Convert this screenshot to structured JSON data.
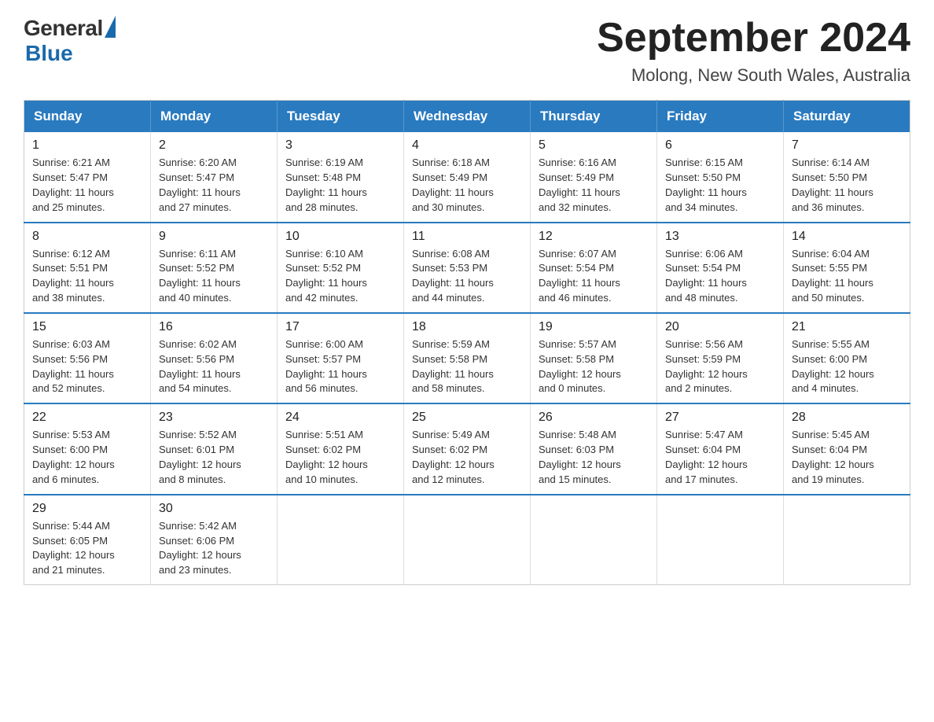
{
  "logo": {
    "general_text": "General",
    "blue_text": "Blue"
  },
  "header": {
    "title": "September 2024",
    "subtitle": "Molong, New South Wales, Australia"
  },
  "weekdays": [
    "Sunday",
    "Monday",
    "Tuesday",
    "Wednesday",
    "Thursday",
    "Friday",
    "Saturday"
  ],
  "weeks": [
    [
      {
        "day": "1",
        "sunrise": "6:21 AM",
        "sunset": "5:47 PM",
        "daylight": "11 hours and 25 minutes."
      },
      {
        "day": "2",
        "sunrise": "6:20 AM",
        "sunset": "5:47 PM",
        "daylight": "11 hours and 27 minutes."
      },
      {
        "day": "3",
        "sunrise": "6:19 AM",
        "sunset": "5:48 PM",
        "daylight": "11 hours and 28 minutes."
      },
      {
        "day": "4",
        "sunrise": "6:18 AM",
        "sunset": "5:49 PM",
        "daylight": "11 hours and 30 minutes."
      },
      {
        "day": "5",
        "sunrise": "6:16 AM",
        "sunset": "5:49 PM",
        "daylight": "11 hours and 32 minutes."
      },
      {
        "day": "6",
        "sunrise": "6:15 AM",
        "sunset": "5:50 PM",
        "daylight": "11 hours and 34 minutes."
      },
      {
        "day": "7",
        "sunrise": "6:14 AM",
        "sunset": "5:50 PM",
        "daylight": "11 hours and 36 minutes."
      }
    ],
    [
      {
        "day": "8",
        "sunrise": "6:12 AM",
        "sunset": "5:51 PM",
        "daylight": "11 hours and 38 minutes."
      },
      {
        "day": "9",
        "sunrise": "6:11 AM",
        "sunset": "5:52 PM",
        "daylight": "11 hours and 40 minutes."
      },
      {
        "day": "10",
        "sunrise": "6:10 AM",
        "sunset": "5:52 PM",
        "daylight": "11 hours and 42 minutes."
      },
      {
        "day": "11",
        "sunrise": "6:08 AM",
        "sunset": "5:53 PM",
        "daylight": "11 hours and 44 minutes."
      },
      {
        "day": "12",
        "sunrise": "6:07 AM",
        "sunset": "5:54 PM",
        "daylight": "11 hours and 46 minutes."
      },
      {
        "day": "13",
        "sunrise": "6:06 AM",
        "sunset": "5:54 PM",
        "daylight": "11 hours and 48 minutes."
      },
      {
        "day": "14",
        "sunrise": "6:04 AM",
        "sunset": "5:55 PM",
        "daylight": "11 hours and 50 minutes."
      }
    ],
    [
      {
        "day": "15",
        "sunrise": "6:03 AM",
        "sunset": "5:56 PM",
        "daylight": "11 hours and 52 minutes."
      },
      {
        "day": "16",
        "sunrise": "6:02 AM",
        "sunset": "5:56 PM",
        "daylight": "11 hours and 54 minutes."
      },
      {
        "day": "17",
        "sunrise": "6:00 AM",
        "sunset": "5:57 PM",
        "daylight": "11 hours and 56 minutes."
      },
      {
        "day": "18",
        "sunrise": "5:59 AM",
        "sunset": "5:58 PM",
        "daylight": "11 hours and 58 minutes."
      },
      {
        "day": "19",
        "sunrise": "5:57 AM",
        "sunset": "5:58 PM",
        "daylight": "12 hours and 0 minutes."
      },
      {
        "day": "20",
        "sunrise": "5:56 AM",
        "sunset": "5:59 PM",
        "daylight": "12 hours and 2 minutes."
      },
      {
        "day": "21",
        "sunrise": "5:55 AM",
        "sunset": "6:00 PM",
        "daylight": "12 hours and 4 minutes."
      }
    ],
    [
      {
        "day": "22",
        "sunrise": "5:53 AM",
        "sunset": "6:00 PM",
        "daylight": "12 hours and 6 minutes."
      },
      {
        "day": "23",
        "sunrise": "5:52 AM",
        "sunset": "6:01 PM",
        "daylight": "12 hours and 8 minutes."
      },
      {
        "day": "24",
        "sunrise": "5:51 AM",
        "sunset": "6:02 PM",
        "daylight": "12 hours and 10 minutes."
      },
      {
        "day": "25",
        "sunrise": "5:49 AM",
        "sunset": "6:02 PM",
        "daylight": "12 hours and 12 minutes."
      },
      {
        "day": "26",
        "sunrise": "5:48 AM",
        "sunset": "6:03 PM",
        "daylight": "12 hours and 15 minutes."
      },
      {
        "day": "27",
        "sunrise": "5:47 AM",
        "sunset": "6:04 PM",
        "daylight": "12 hours and 17 minutes."
      },
      {
        "day": "28",
        "sunrise": "5:45 AM",
        "sunset": "6:04 PM",
        "daylight": "12 hours and 19 minutes."
      }
    ],
    [
      {
        "day": "29",
        "sunrise": "5:44 AM",
        "sunset": "6:05 PM",
        "daylight": "12 hours and 21 minutes."
      },
      {
        "day": "30",
        "sunrise": "5:42 AM",
        "sunset": "6:06 PM",
        "daylight": "12 hours and 23 minutes."
      },
      null,
      null,
      null,
      null,
      null
    ]
  ],
  "labels": {
    "sunrise_prefix": "Sunrise: ",
    "sunset_prefix": "Sunset: ",
    "daylight_prefix": "Daylight: "
  }
}
